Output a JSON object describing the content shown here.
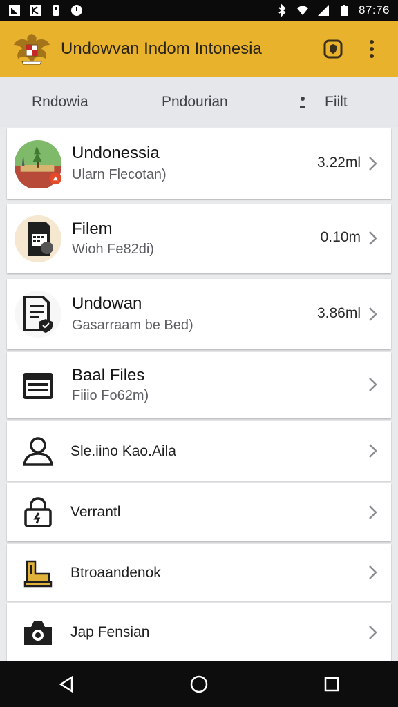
{
  "status_bar": {
    "time": "87:76",
    "left_icons": [
      "notification-icon",
      "media-icon",
      "battery-saver-icon",
      "sync-icon"
    ],
    "right_icons": [
      "bluetooth-icon",
      "wifi-icon",
      "signal-icon",
      "battery-icon"
    ]
  },
  "app_bar": {
    "title": "Undowvan Indom Intonesia",
    "action_icons": [
      "shield-icon",
      "more-vert-icon"
    ]
  },
  "tabs": [
    {
      "label": "Rndowia"
    },
    {
      "label": "Pndourian"
    },
    {
      "label": "Fiilt"
    }
  ],
  "list": {
    "items": [
      {
        "title": "Undonessia",
        "subtitle": "Ularn Flecotan)",
        "size": "3.22ml",
        "icon": "landscape-icon"
      },
      {
        "title": "Filem",
        "subtitle": "Wioh Fe82di)",
        "size": "0.10m",
        "icon": "sd-card-icon"
      },
      {
        "title": "Undowan",
        "subtitle": "Gasarraam be Bed)",
        "size": "3.86ml",
        "icon": "document-shield-icon"
      },
      {
        "title": "Baal Files",
        "subtitle": "Fiiio Fo62m)",
        "icon": "folder-list-icon"
      },
      {
        "label": "Sle.iino Kao.Aila",
        "icon": "user-icon"
      },
      {
        "label": "Verrantl",
        "icon": "lock-icon"
      },
      {
        "label": "Btroaandenok",
        "icon": "stamp-icon"
      },
      {
        "label": "Jap Fensian",
        "icon": "camera-icon"
      }
    ]
  },
  "colors": {
    "app_bar": "#e8b22c",
    "status_bar": "#0b0b0b",
    "nav_bar": "#0d0d0d",
    "card": "#ffffff",
    "background": "#e9eaec"
  },
  "nav_bar": {
    "icons": [
      "back-icon",
      "home-icon",
      "recents-icon"
    ]
  }
}
